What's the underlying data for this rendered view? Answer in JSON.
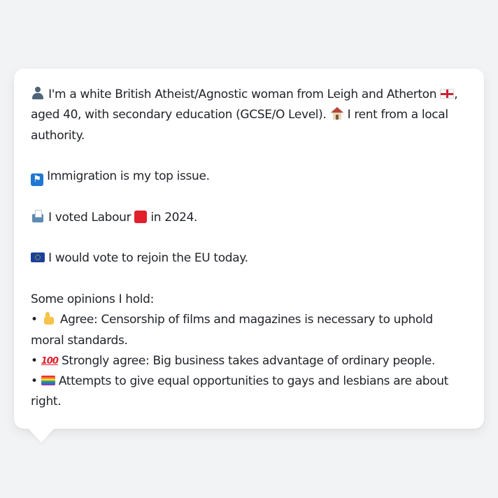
{
  "profile": {
    "intro_1": "I'm a white British Atheist/Agnostic woman from Leigh and Atherton",
    "intro_2": ", aged 40, with secondary education (GCSE/O Level).",
    "intro_3": "I rent from a local authority.",
    "top_issue": "Immigration is my top issue.",
    "vote_prefix": "I voted Labour",
    "vote_suffix": "in 2024.",
    "eu": "I would vote to rejoin the EU today.",
    "opinions_heading": "Some opinions I hold:",
    "opinions": [
      {
        "bullet": "•",
        "text": "Agree: Censorship of films and magazines is necessary to uphold moral standards."
      },
      {
        "bullet": "•",
        "text": "Strongly agree: Big business takes advantage of ordinary people."
      },
      {
        "bullet": "•",
        "text": "Attempts to give equal opportunities to gays and lesbians are about right."
      }
    ]
  },
  "icons": {
    "person": "person-silhouette-icon",
    "england_flag": "england-flag-icon",
    "house": "house-icon",
    "passport_control": "passport-control-icon",
    "ballot_box": "ballot-box-icon",
    "labour_square": "red-square-icon",
    "eu_flag": "eu-flag-icon",
    "thumbs_up": "thumbs-up-icon",
    "hundred": "hundred-points-icon",
    "rainbow_flag": "rainbow-flag-icon",
    "hundred_text": "100"
  },
  "colors": {
    "background": "#f2f3f5",
    "card": "#ffffff",
    "text": "#1f2328",
    "labour_red": "#e0202c",
    "eu_blue": "#1b3f9b"
  }
}
